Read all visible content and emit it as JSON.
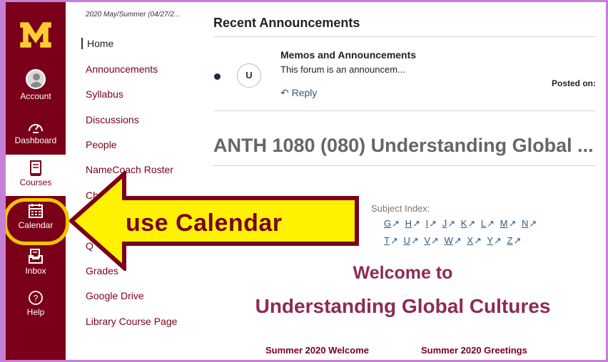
{
  "global_nav": {
    "items": [
      {
        "label": "Account",
        "icon": "account-avatar-icon"
      },
      {
        "label": "Dashboard",
        "icon": "dashboard-gauge-icon"
      },
      {
        "label": "Courses",
        "icon": "courses-book-icon"
      },
      {
        "label": "Calendar",
        "icon": "calendar-icon"
      },
      {
        "label": "Inbox",
        "icon": "inbox-icon"
      },
      {
        "label": "Help",
        "icon": "help-icon"
      }
    ],
    "logo_letter": "M"
  },
  "course_nav": {
    "term": "2020 May/Summer (04/27/2...",
    "items": [
      "Home",
      "Announcements",
      "Syllabus",
      "Discussions",
      "People",
      "NameCoach Roster",
      "Ch",
      "Q",
      "Grades",
      "Google Drive",
      "Library Course Page"
    ]
  },
  "main": {
    "recent_announcements_title": "Recent Announcements",
    "announcement": {
      "avatar_initial": "U",
      "title": "Memos and Announcements",
      "message": "This forum is an announcem...",
      "reply_label": "Reply",
      "posted_on": "Posted on:"
    },
    "course_title": "ANTH 1080 (080) Understanding Global ...",
    "subject_index_label": "Subject Index:",
    "subject_row1": [
      "G",
      "H",
      "I",
      "J",
      "K",
      "L",
      "M",
      "N"
    ],
    "subject_row2": [
      "T",
      "U",
      "V",
      "W",
      "X",
      "Y",
      "Z"
    ],
    "welcome_line1": "Welcome to",
    "welcome_line2": "Understanding Global Cultures",
    "links": [
      "Summer 2020 Welcome",
      "Summer 2020 Greetings"
    ]
  },
  "annotation": {
    "text": "use Calendar"
  },
  "colors": {
    "maroon": "#7a0019",
    "gold": "#ffcc33",
    "frame": "#c77fd6",
    "arrow_fill": "#fff200",
    "link_blue": "#2d5a80",
    "welcome": "#8e2a54"
  }
}
